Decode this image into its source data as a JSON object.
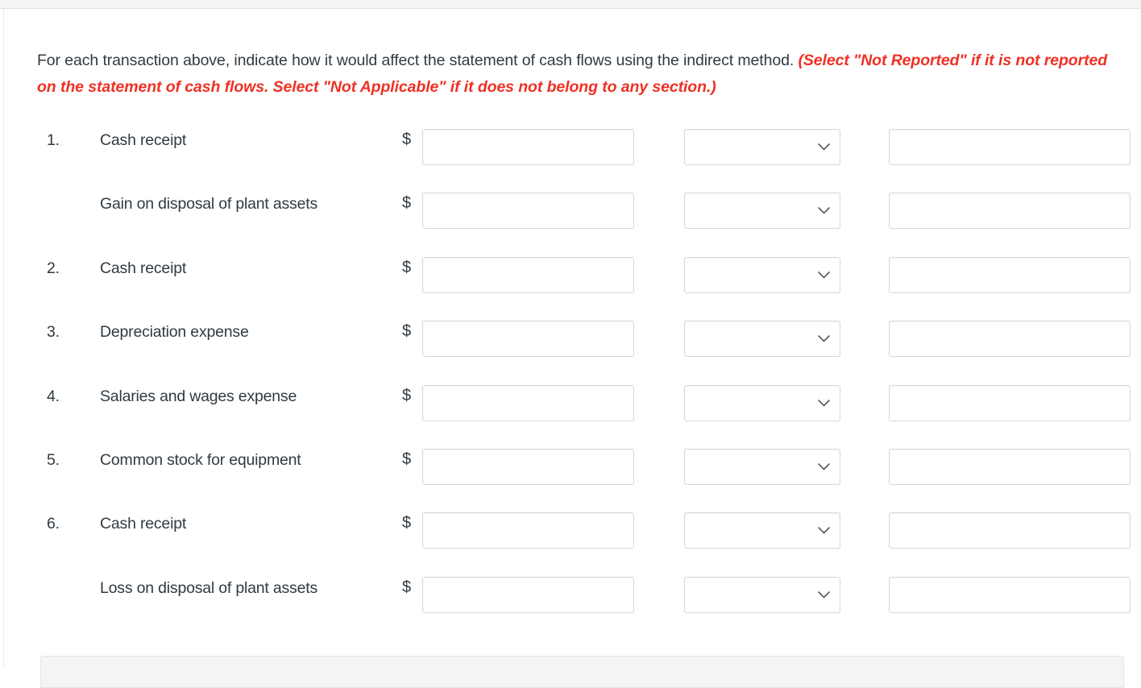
{
  "page": {
    "top_band_color": "#f4f4f4",
    "background_color": "#ffffff",
    "text_color": "#303a42",
    "accent_color": "#ee3124",
    "field_border_color": "#d7d7d7"
  },
  "instructions": {
    "plain_text": "For each transaction above, indicate how it would affect the statement of cash flows using the indirect method.",
    "emphasis_text": "(Select \"Not Reported\" if it is not reported on the statement of cash flows. Select \"Not Applicable\" if it does not belong to any section.)"
  },
  "rows": [
    {
      "number": "1.",
      "label": "Cash receipt",
      "currency_symbol": "$",
      "amount_value": "",
      "amount_placeholder": "",
      "select_value": "",
      "section_value": "",
      "section_placeholder": ""
    },
    {
      "number": "",
      "label": "Gain on disposal of plant assets",
      "currency_symbol": "$",
      "amount_value": "",
      "amount_placeholder": "",
      "select_value": "",
      "section_value": "",
      "section_placeholder": ""
    },
    {
      "number": "2.",
      "label": "Cash receipt",
      "currency_symbol": "$",
      "amount_value": "",
      "amount_placeholder": "",
      "select_value": "",
      "section_value": "",
      "section_placeholder": ""
    },
    {
      "number": "3.",
      "label": "Depreciation expense",
      "currency_symbol": "$",
      "amount_value": "",
      "amount_placeholder": "",
      "select_value": "",
      "section_value": "",
      "section_placeholder": ""
    },
    {
      "number": "4.",
      "label": "Salaries and wages expense",
      "currency_symbol": "$",
      "amount_value": "",
      "amount_placeholder": "",
      "select_value": "",
      "section_value": "",
      "section_placeholder": ""
    },
    {
      "number": "5.",
      "label": "Common stock for equipment",
      "currency_symbol": "$",
      "amount_value": "",
      "amount_placeholder": "",
      "select_value": "",
      "section_value": "",
      "section_placeholder": ""
    },
    {
      "number": "6.",
      "label": "Cash receipt",
      "currency_symbol": "$",
      "amount_value": "",
      "amount_placeholder": "",
      "select_value": "",
      "section_value": "",
      "section_placeholder": ""
    },
    {
      "number": "",
      "label": "Loss on disposal of plant assets",
      "currency_symbol": "$",
      "amount_value": "",
      "amount_placeholder": "",
      "select_value": "",
      "section_value": "",
      "section_placeholder": ""
    }
  ],
  "icons": {
    "dropdown_chevron": "chevron-down-icon"
  }
}
